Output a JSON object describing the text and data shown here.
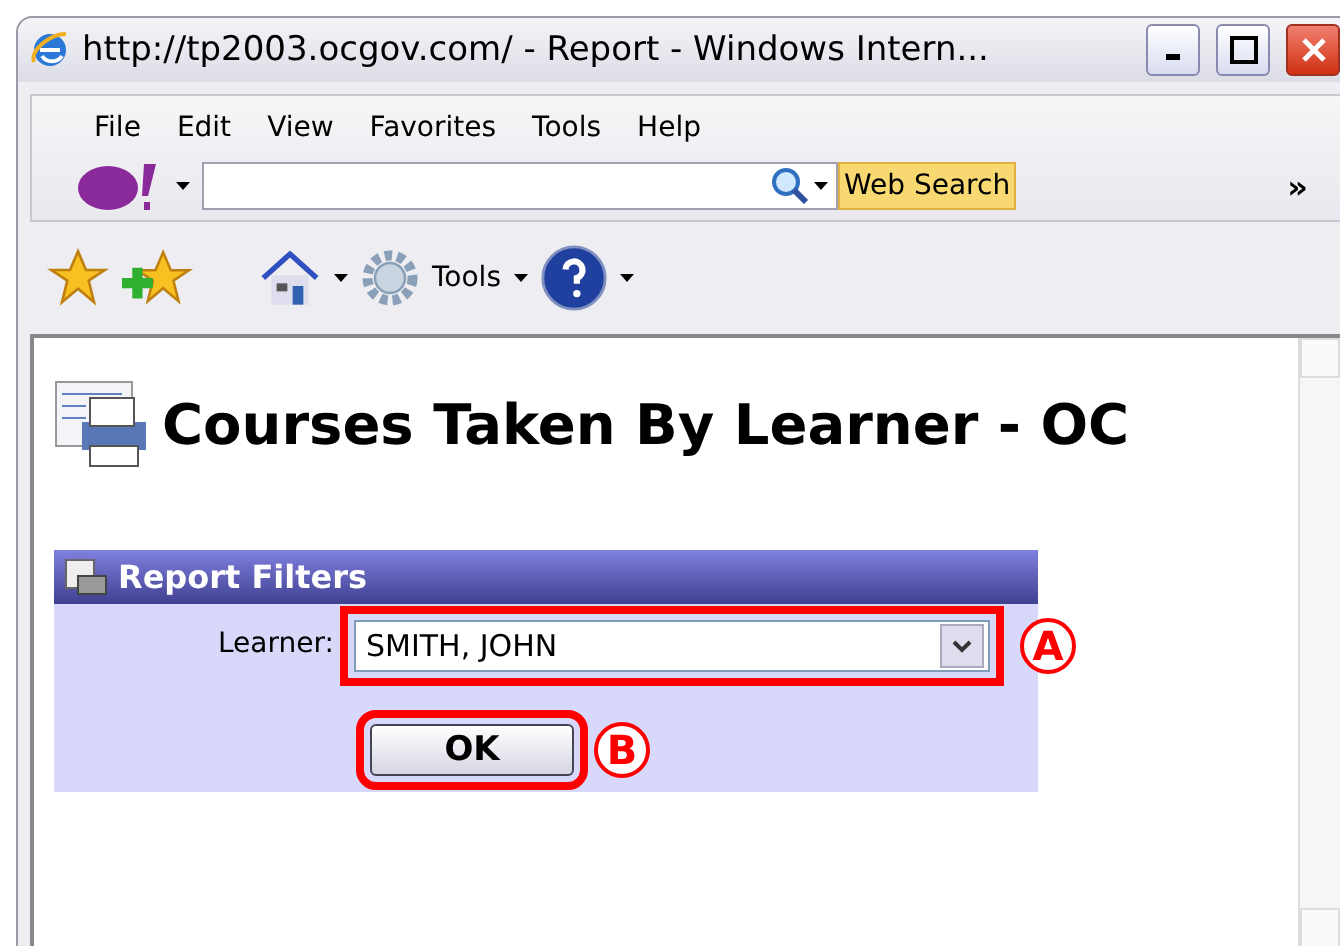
{
  "window": {
    "title": "http://tp2003.ocgov.com/ - Report - Windows Intern..."
  },
  "menu": [
    "File",
    "Edit",
    "View",
    "Favorites",
    "Tools",
    "Help"
  ],
  "search_bar": {
    "button": "Web Search",
    "overflow": "»"
  },
  "toolbar": {
    "tools_label": "Tools"
  },
  "page": {
    "heading": "Courses Taken By Learner - OC",
    "filters": {
      "title": "Report Filters",
      "learner_label": "Learner:",
      "learner_value": "SMITH, JOHN",
      "ok": "OK"
    }
  },
  "callouts": [
    {
      "letter": "A"
    },
    {
      "letter": "B"
    }
  ]
}
